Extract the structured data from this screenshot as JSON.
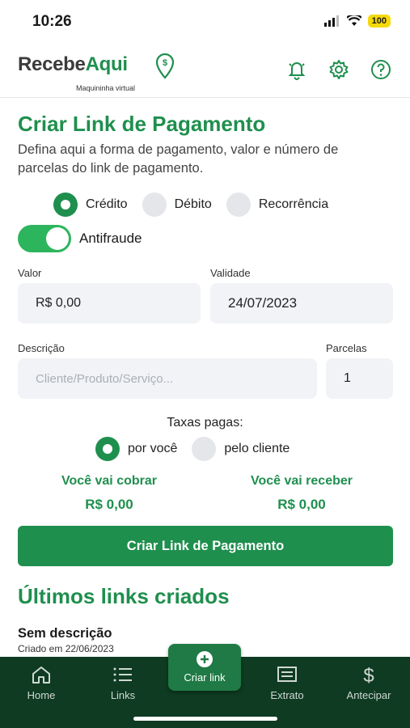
{
  "status": {
    "time": "10:26",
    "battery": "100"
  },
  "brand": {
    "name_part1": "Recebe",
    "name_part2": "Aqui",
    "tagline": "Maquininha virtual"
  },
  "header_icons": [
    "bell-icon",
    "gear-icon",
    "help-icon"
  ],
  "form": {
    "title": "Criar Link de Pagamento",
    "subtitle": "Defina aqui a forma de pagamento, valor e número de parcelas do link de pagamento.",
    "payment_types": [
      {
        "label": "Crédito",
        "selected": true
      },
      {
        "label": "Débito",
        "selected": false
      },
      {
        "label": "Recorrência",
        "selected": false
      }
    ],
    "antifraude": {
      "label": "Antifraude",
      "on": true
    },
    "valor": {
      "label": "Valor",
      "value": "R$ 0,00"
    },
    "validade": {
      "label": "Validade",
      "value": "24/07/2023"
    },
    "descricao": {
      "label": "Descrição",
      "placeholder": "Cliente/Produto/Serviço..."
    },
    "parcelas": {
      "label": "Parcelas",
      "value": "1"
    },
    "taxas": {
      "title": "Taxas pagas:",
      "options": [
        {
          "label": "por você",
          "selected": true
        },
        {
          "label": "pelo cliente",
          "selected": false
        }
      ]
    },
    "cobrar": {
      "label": "Você vai cobrar",
      "value": "R$ 0,00"
    },
    "receber": {
      "label": "Você vai receber",
      "value": "R$ 0,00"
    },
    "submit_label": "Criar Link de Pagamento"
  },
  "recent": {
    "title": "Últimos links criados",
    "items": [
      {
        "title": "Sem descrição",
        "date": "Criado em 22/06/2023"
      }
    ]
  },
  "nav": {
    "home": "Home",
    "links": "Links",
    "criar": "Criar link",
    "extrato": "Extrato",
    "antecipar": "Antecipar"
  },
  "colors": {
    "brand_green": "#1f8f4e",
    "nav_bg": "#0e3b22",
    "toggle_on": "#2db55d"
  }
}
